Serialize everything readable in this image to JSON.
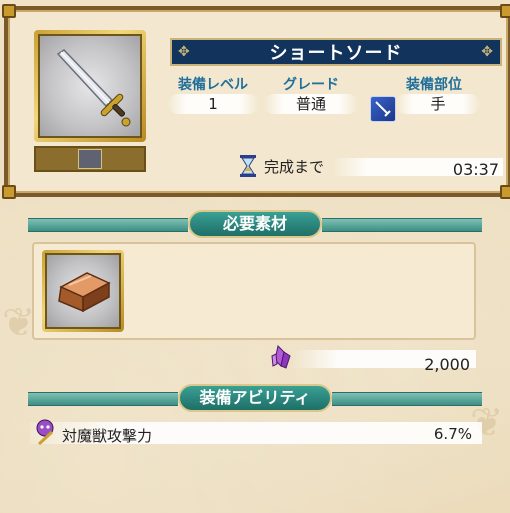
{
  "item": {
    "name": "ショートソード",
    "icon": "short-sword-icon",
    "equip_level_label": "装備レベル",
    "equip_level": "1",
    "grade_label": "グレード",
    "grade": "普通",
    "equip_slot_label": "装備部位",
    "equip_slot": "手",
    "slot_icon": "sword-slot-icon"
  },
  "timer": {
    "label": "完成まで",
    "value": "03:37",
    "icon": "hourglass-icon"
  },
  "materials": {
    "header": "必要素材",
    "items": [
      {
        "icon": "copper-ingot-icon"
      }
    ],
    "cost": {
      "icon": "crystal-icon",
      "value": "2,000"
    }
  },
  "abilities": {
    "header": "装備アビリティ",
    "items": [
      {
        "icon": "monster-attack-icon",
        "label": "対魔獣攻撃力",
        "value": "6.7%"
      }
    ]
  },
  "colors": {
    "banner": "#12335c",
    "accent_teal": "#2b8a80",
    "label_blue": "#1f6f9a",
    "frame_gold": "#d4aa3e"
  }
}
